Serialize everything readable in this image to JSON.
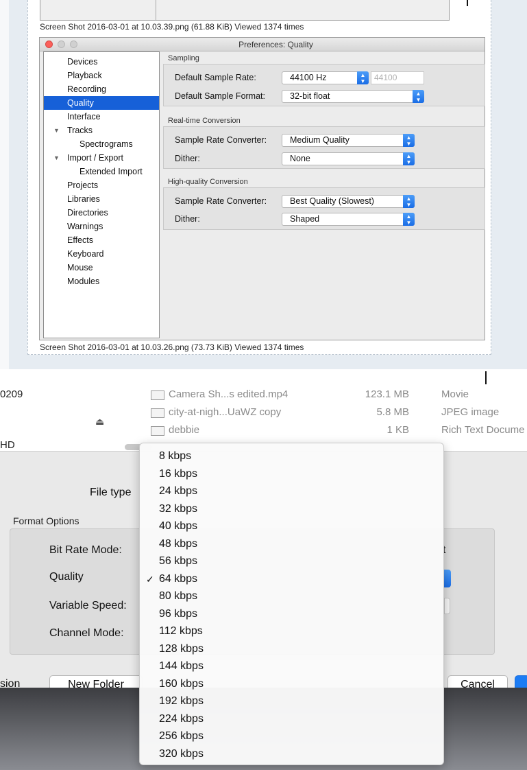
{
  "forum": {
    "caption_top": "Screen Shot 2016-03-01 at 10.03.39.png (61.88 KiB) Viewed 1374 times",
    "caption_bottom": "Screen Shot 2016-03-01 at 10.03.26.png (73.73 KiB) Viewed 1374 times"
  },
  "prefs": {
    "title": "Preferences: Quality",
    "nav": [
      {
        "label": "Devices",
        "indent": 0,
        "triangle": ""
      },
      {
        "label": "Playback",
        "indent": 0,
        "triangle": ""
      },
      {
        "label": "Recording",
        "indent": 0,
        "triangle": ""
      },
      {
        "label": "Quality",
        "indent": 0,
        "triangle": "",
        "selected": true
      },
      {
        "label": "Interface",
        "indent": 0,
        "triangle": ""
      },
      {
        "label": "Tracks",
        "indent": 0,
        "triangle": "▼"
      },
      {
        "label": "Spectrograms",
        "indent": 1,
        "triangle": ""
      },
      {
        "label": "Import / Export",
        "indent": 0,
        "triangle": "▼"
      },
      {
        "label": "Extended Import",
        "indent": 1,
        "triangle": ""
      },
      {
        "label": "Projects",
        "indent": 0,
        "triangle": ""
      },
      {
        "label": "Libraries",
        "indent": 0,
        "triangle": ""
      },
      {
        "label": "Directories",
        "indent": 0,
        "triangle": ""
      },
      {
        "label": "Warnings",
        "indent": 0,
        "triangle": ""
      },
      {
        "label": "Effects",
        "indent": 0,
        "triangle": ""
      },
      {
        "label": "Keyboard",
        "indent": 0,
        "triangle": ""
      },
      {
        "label": "Mouse",
        "indent": 0,
        "triangle": ""
      },
      {
        "label": "Modules",
        "indent": 0,
        "triangle": ""
      }
    ],
    "sampling": {
      "group": "Sampling",
      "rate_label": "Default Sample Rate:",
      "rate_value": "44100 Hz",
      "rate_field": "44100",
      "format_label": "Default Sample Format:",
      "format_value": "32-bit float"
    },
    "realtime": {
      "group": "Real-time Conversion",
      "converter_label": "Sample Rate Converter:",
      "converter_value": "Medium Quality",
      "dither_label": "Dither:",
      "dither_value": "None"
    },
    "highquality": {
      "group": "High-quality Conversion",
      "converter_label": "Sample Rate Converter:",
      "converter_value": "Best Quality (Slowest)",
      "dither_label": "Dither:",
      "dither_value": "Shaped"
    }
  },
  "save_dialog": {
    "sidebar_device": "0209",
    "sidebar_hd": "HD",
    "files": [
      {
        "name": "Camera Sh...s edited.mp4",
        "size": "123.1 MB",
        "kind": "Movie"
      },
      {
        "name": "city-at-nigh...UaWZ copy",
        "size": "5.8 MB",
        "kind": "JPEG image"
      },
      {
        "name": "debbie",
        "size": "1 KB",
        "kind": "Rich Text Docume"
      }
    ],
    "file_type_label": "File type",
    "format_options": "Format Options",
    "bit_rate_mode_label": "Bit Rate Mode:",
    "bit_rate_mode_tail": "t",
    "quality_label": "Quality",
    "variable_speed_label": "Variable Speed:",
    "channel_mode_label": "Channel Mode:",
    "left_cut_label": "sion",
    "new_folder": "New Folder",
    "cancel": "Cancel"
  },
  "bitrate_menu": {
    "items": [
      "8 kbps",
      "16 kbps",
      "24 kbps",
      "32 kbps",
      "40 kbps",
      "48 kbps",
      "56 kbps",
      "64 kbps",
      "80 kbps",
      "96 kbps",
      "112 kbps",
      "128 kbps",
      "144 kbps",
      "160 kbps",
      "192 kbps",
      "224 kbps",
      "256 kbps",
      "320 kbps"
    ],
    "checked": "64 kbps",
    "check_glyph": "✓"
  },
  "icons": {
    "eject": "⏏",
    "stepper": "▲▼"
  },
  "colors": {
    "selection_blue": "#1660d8",
    "popup_blue": "#1a6de6",
    "traffic_red": "#fc605b"
  }
}
